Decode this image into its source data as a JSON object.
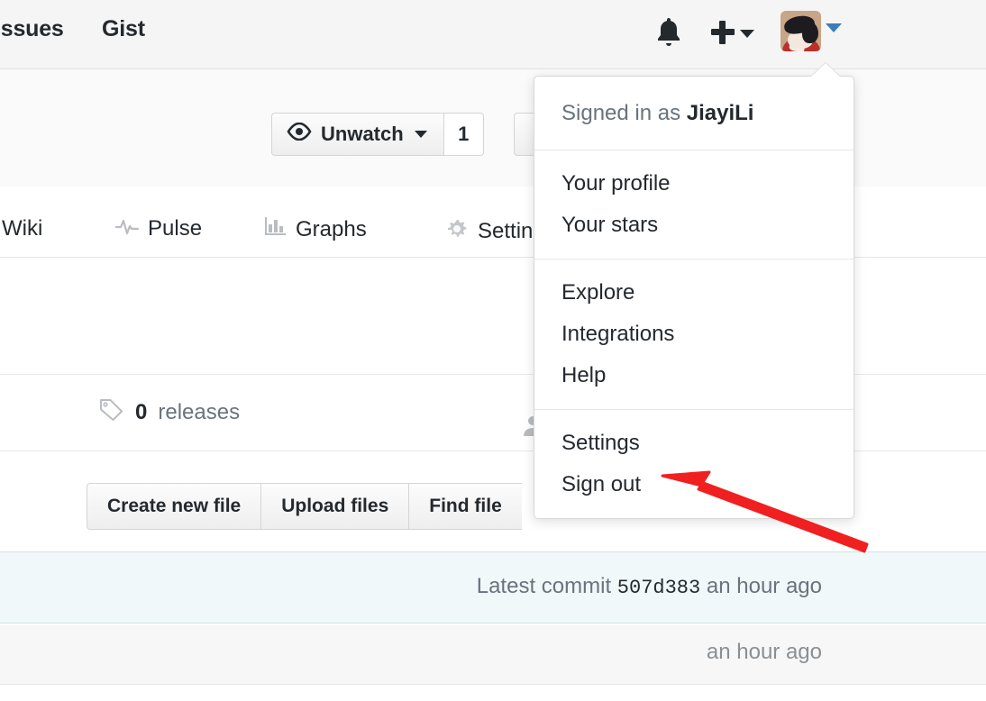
{
  "header": {
    "nav": [
      {
        "label": "Issues",
        "name": "nav-issues"
      },
      {
        "label": "Gist",
        "name": "nav-gist"
      }
    ],
    "icons": {
      "notifications": "bell-icon",
      "create_new": "plus-icon",
      "create_new_caret": "chevron-down-icon",
      "avatar": "user-avatar",
      "avatar_caret": "chevron-down-icon"
    }
  },
  "repo_header": {
    "watch": {
      "icon": "eye-icon",
      "label": "Unwatch",
      "caret": "chevron-down-icon",
      "count": "1"
    }
  },
  "repo_tabs": [
    {
      "label": "Wiki",
      "icon": "book-icon"
    },
    {
      "label": "Pulse",
      "icon": "pulse-icon"
    },
    {
      "label": "Graphs",
      "icon": "bar-chart-icon"
    },
    {
      "label": "Settings",
      "icon": "gear-icon"
    }
  ],
  "releases": {
    "icon": "tag-icon",
    "count": "0",
    "label": "releases"
  },
  "file_actions": [
    {
      "label": "Create new file"
    },
    {
      "label": "Upload files"
    },
    {
      "label": "Find file"
    }
  ],
  "commit_bar": {
    "prefix": "Latest commit",
    "sha": "507d383",
    "time": "an hour ago"
  },
  "file_row": {
    "time": "an hour ago"
  },
  "user_menu": {
    "signed_in_prefix": "Signed in as",
    "username": "JiayiLi",
    "groups": [
      {
        "items": [
          {
            "label": "Your profile",
            "name": "menu-item-your-profile"
          },
          {
            "label": "Your stars",
            "name": "menu-item-your-stars"
          }
        ]
      },
      {
        "items": [
          {
            "label": "Explore",
            "name": "menu-item-explore"
          },
          {
            "label": "Integrations",
            "name": "menu-item-integrations"
          },
          {
            "label": "Help",
            "name": "menu-item-help"
          }
        ]
      },
      {
        "items": [
          {
            "label": "Settings",
            "name": "menu-item-settings"
          },
          {
            "label": "Sign out",
            "name": "menu-item-sign-out"
          }
        ]
      }
    ]
  },
  "annotation": {
    "type": "arrow",
    "color": "#f02020",
    "points_at": "Settings"
  },
  "colors": {
    "header_bg": "#f5f5f5",
    "page_bg": "#ffffff",
    "text": "#24292e",
    "muted_text": "#6a737d",
    "accent_blue": "#3c7eb8",
    "commit_bar_bg": "#f1f8fa",
    "file_row_bg": "#f7f7f7",
    "annotation_red": "#f02020"
  }
}
